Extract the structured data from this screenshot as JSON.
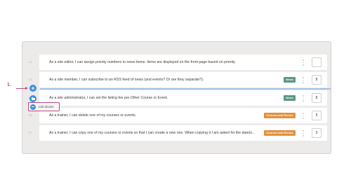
{
  "annotation": {
    "step_label": "1."
  },
  "rows": [
    {
      "num": "13",
      "text": "As a site editor, I can assign priority numbers to news items. Items are displayed on the front page based on priority.",
      "tag": "",
      "priority": ""
    },
    {
      "num": "14",
      "text": "As a site member, I can subscribe to an RSS feed of news (and events? Or are they separate?).",
      "tag": "News",
      "priority": "8"
    },
    {
      "num": "15",
      "text": "As a site administrator, I can set the listing fee per Other Course or Event.",
      "tag": "News",
      "priority": "8"
    },
    {
      "num": "16",
      "text": "As a trainer, I can delete one of my courses or events.",
      "tag": "Courses and Events",
      "priority": "5"
    },
    {
      "num": "17",
      "text": "As a trainer, I can copy one of my courses or events so that I can create a new one. When copying it I am asked for the date(s...",
      "tag": "Courses and Events",
      "priority": "3"
    }
  ],
  "insert_menu": {
    "add_item_glyph": "+",
    "add_divider_label": "Add divider"
  },
  "colors": {
    "news_tag": "#5c9684",
    "courses_tag": "#e2913f",
    "accent_blue": "#3b8fe0",
    "annotation_pink": "#c2477f"
  }
}
